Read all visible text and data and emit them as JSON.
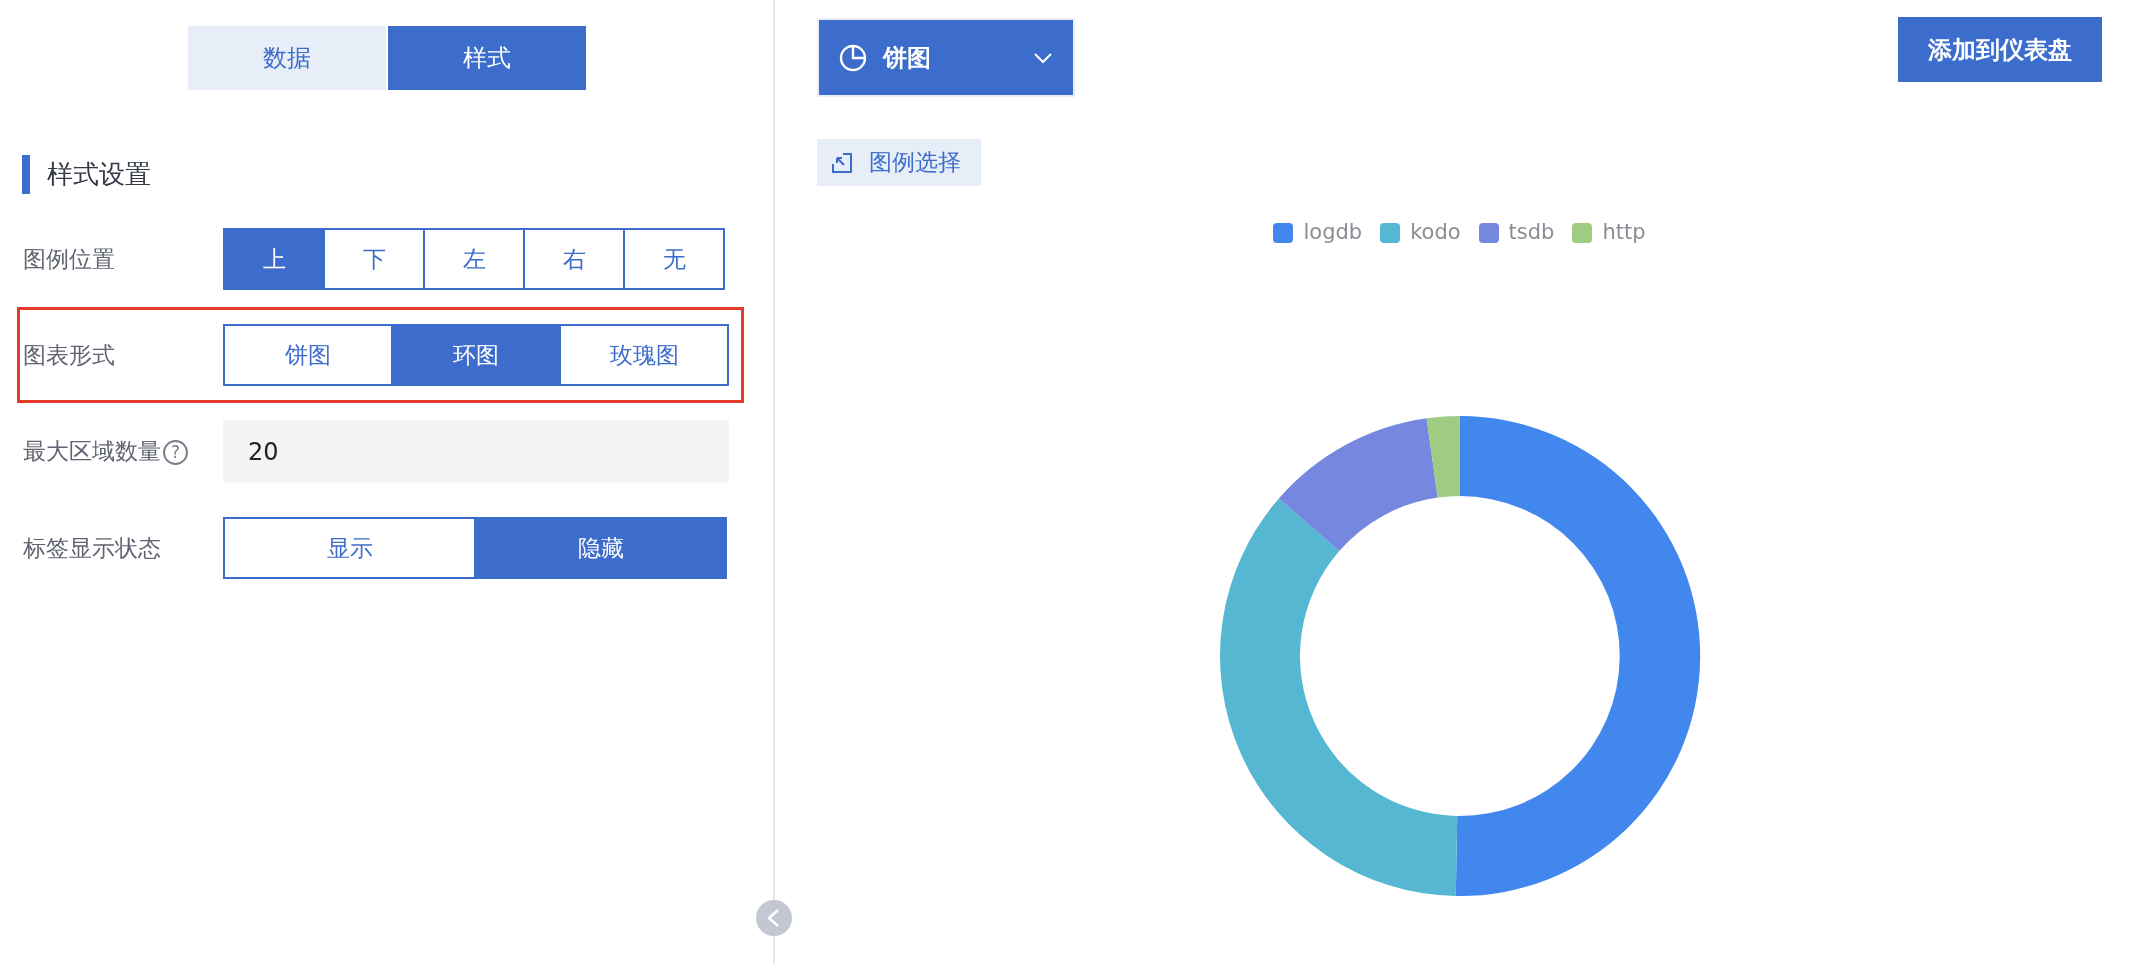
{
  "tabs": [
    {
      "label": "数据",
      "selected": false
    },
    {
      "label": "样式",
      "selected": true
    }
  ],
  "section_title": "样式设置",
  "settings": [
    {
      "kind": "segmented",
      "label": "图例位置",
      "highlighted": false,
      "options": [
        {
          "label": "上",
          "selected": true
        },
        {
          "label": "下",
          "selected": false
        },
        {
          "label": "左",
          "selected": false
        },
        {
          "label": "右",
          "selected": false
        },
        {
          "label": "无",
          "selected": false
        }
      ]
    },
    {
      "kind": "segmented",
      "label": "图表形式",
      "highlighted": true,
      "options": [
        {
          "label": "饼图",
          "selected": false
        },
        {
          "label": "环图",
          "selected": true
        },
        {
          "label": "玫瑰图",
          "selected": false
        }
      ]
    },
    {
      "kind": "number",
      "label": "最大区域数量",
      "highlighted": false,
      "help": "?",
      "value": "20"
    },
    {
      "kind": "segmented",
      "label": "标签显示状态",
      "highlighted": false,
      "options": [
        {
          "label": "显示",
          "selected": false
        },
        {
          "label": "隐藏",
          "selected": true
        }
      ]
    }
  ],
  "chart_type_select": {
    "label": "饼图"
  },
  "add_button": "添加到仪表盘",
  "legend_select_button": "图例选择",
  "chart": {
    "legend": [
      {
        "name": "logdb",
        "color": "#4287ee"
      },
      {
        "name": "kodo",
        "color": "#55b7d1"
      },
      {
        "name": "tsdb",
        "color": "#7587de"
      },
      {
        "name": "http",
        "color": "#a0cb82"
      }
    ]
  }
}
